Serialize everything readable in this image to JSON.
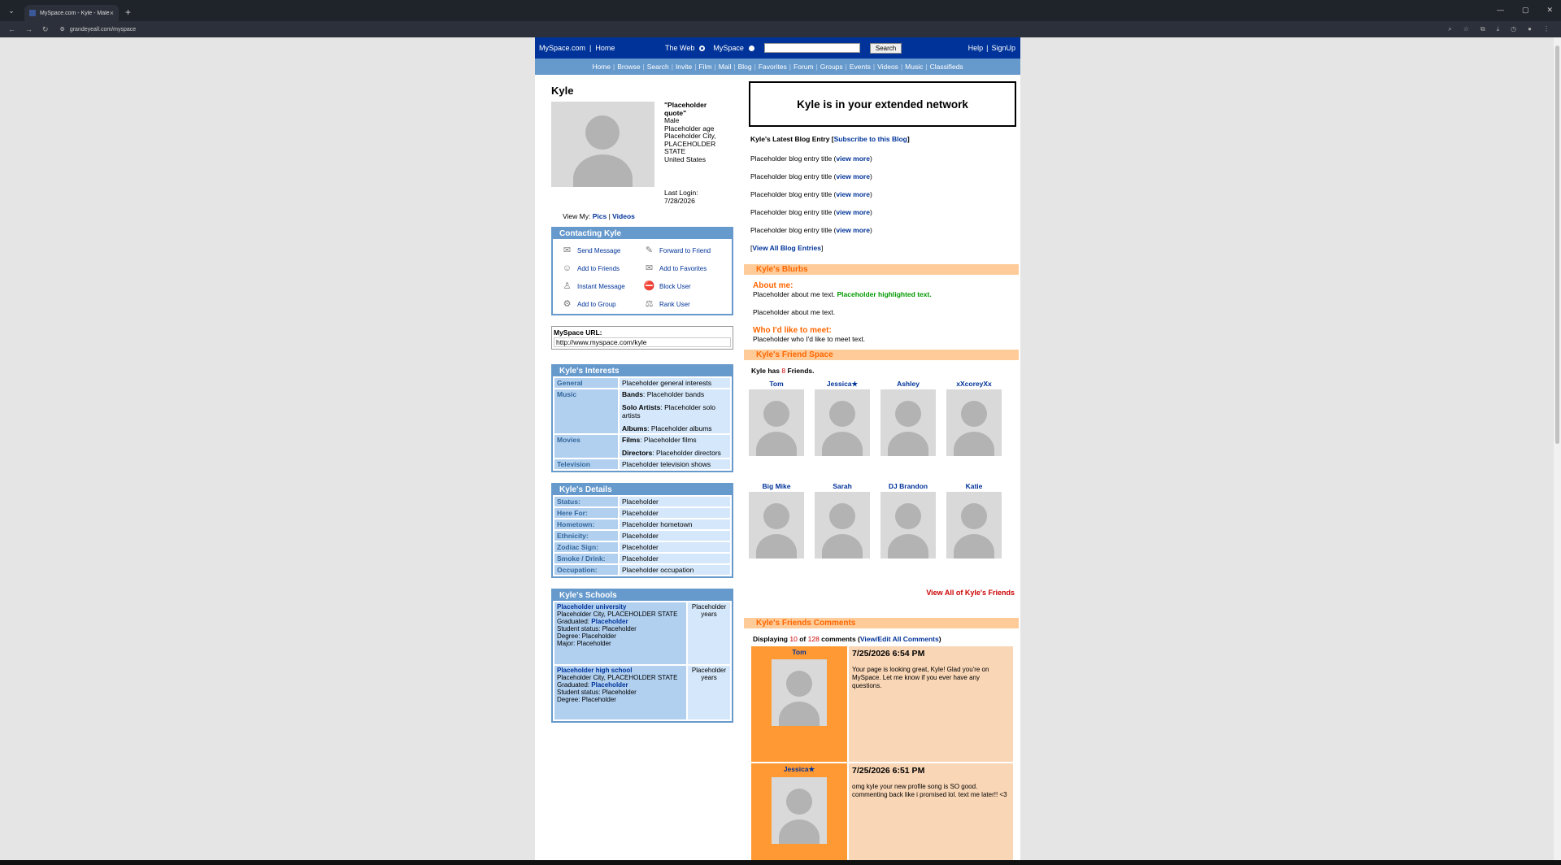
{
  "browser": {
    "tab_title": "MySpace.com - Kyle - Male - ...",
    "url": "grandeyeall.com/myspace"
  },
  "topnav": {
    "home_link": "MySpace.com",
    "sep": "|",
    "home": "Home",
    "web_label": "The Web",
    "myspace_label": "MySpace",
    "search_button": "Search",
    "help": "Help",
    "signup": "SignUp"
  },
  "subnav": [
    "Home",
    "Browse",
    "Search",
    "Invite",
    "Film",
    "Mail",
    "Blog",
    "Favorites",
    "Forum",
    "Groups",
    "Events",
    "Videos",
    "Music",
    "Classifieds"
  ],
  "profile": {
    "name": "Kyle",
    "quote": "\"Placeholder quote\"",
    "gender": "Male",
    "age": "Placeholder age",
    "location": "Placeholder City, PLACEHOLDER STATE",
    "country": "United States",
    "last_login_label": "Last Login:",
    "last_login": "7/28/2026",
    "view_my": "View My:",
    "pics": "Pics",
    "videos": "Videos"
  },
  "contacting": {
    "title": "Contacting Kyle",
    "send_message": "Send Message",
    "forward": "Forward to Friend",
    "add_friends": "Add to Friends",
    "add_favorites": "Add to Favorites",
    "instant_message": "Instant Message",
    "block": "Block User",
    "add_group": "Add to Group",
    "rank": "Rank User"
  },
  "myspace_url": {
    "label": "MySpace URL:",
    "value": "http://www.myspace.com/kyle"
  },
  "interests": {
    "title": "Kyle's Interests",
    "general_label": "General",
    "general": "Placeholder general interests",
    "music_label": "Music",
    "bands_label": "Bands",
    "bands": ": Placeholder bands",
    "solo_label": "Solo Artists",
    "solo": ": Placeholder solo artists",
    "albums_label": "Albums",
    "albums": ": Placeholder albums",
    "movies_label": "Movies",
    "films_label": "Films",
    "films": ": Placeholder films",
    "directors_label": "Directors",
    "directors": ": Placeholder directors",
    "tv_label": "Television",
    "tv": "Placeholder television shows"
  },
  "details": {
    "title": "Kyle's Details",
    "rows": [
      {
        "label": "Status:",
        "value": "Placeholder"
      },
      {
        "label": "Here For:",
        "value": "Placeholder"
      },
      {
        "label": "Hometown:",
        "value": "Placeholder hometown"
      },
      {
        "label": "Ethnicity:",
        "value": "Placeholder"
      },
      {
        "label": "Zodiac Sign:",
        "value": "Placeholder"
      },
      {
        "label": "Smoke / Drink:",
        "value": "Placeholder"
      },
      {
        "label": "Occupation:",
        "value": "Placeholder occupation"
      }
    ]
  },
  "schools": {
    "title": "Kyle's Schools",
    "list": [
      {
        "name": "Placeholder university",
        "location": "Placeholder City, PLACEHOLDER STATE",
        "graduated_label": "Graduated:",
        "graduated": "Placeholder",
        "status": "Student status: Placeholder",
        "degree": "Degree: Placeholder",
        "major": "Major: Placeholder",
        "years": "Placeholder years"
      },
      {
        "name": "Placeholder high school",
        "location": "Placeholder City, PLACEHOLDER STATE",
        "graduated_label": "Graduated:",
        "graduated": "Placeholder",
        "status": "Student status: Placeholder",
        "degree": "Degree: Placeholder",
        "years": "Placeholder years"
      }
    ]
  },
  "network": "Kyle is in your extended network",
  "blog": {
    "heading": "Kyle's Latest Blog Entry",
    "subscribe": "Subscribe to this Blog",
    "entry": "Placeholder blog entry title",
    "view_more": "view more",
    "view_all": "View All Blog Entries"
  },
  "blurbs": {
    "title": "Kyle's Blurbs",
    "about_label": "About me:",
    "about_1": "Placeholder about me text.",
    "about_hl": "Placeholder highlighted text.",
    "about_2": "Placeholder about me text.",
    "meet_label": "Who I'd like to meet:",
    "meet": "Placeholder who I'd like to meet text."
  },
  "friends": {
    "title": "Kyle's Friend Space",
    "count_pre": "Kyle has",
    "count": "8",
    "count_post": "Friends.",
    "list": [
      "Tom",
      "Jessica★",
      "Ashley",
      "xXcoreyXx",
      "Big Mike",
      "Sarah",
      "DJ Brandon",
      "Katie"
    ],
    "view_all": "View All of Kyle's Friends"
  },
  "comments": {
    "title": "Kyle's Friends Comments",
    "displaying": "Displaying",
    "shown": "10",
    "of": "of",
    "total": "128",
    "comments_word": "comments",
    "view_edit": "View/Edit All Comments",
    "list": [
      {
        "author": "Tom",
        "time": "7/25/2026 6:54 PM",
        "text": "Your page is looking great, Kyle! Glad you're on MySpace. Let me know if you ever have any questions."
      },
      {
        "author": "Jessica★",
        "time": "7/25/2026 6:51 PM",
        "text": "omg kyle your new profile song is SO good. commenting back like i promised lol. text me later!! <3"
      }
    ]
  }
}
